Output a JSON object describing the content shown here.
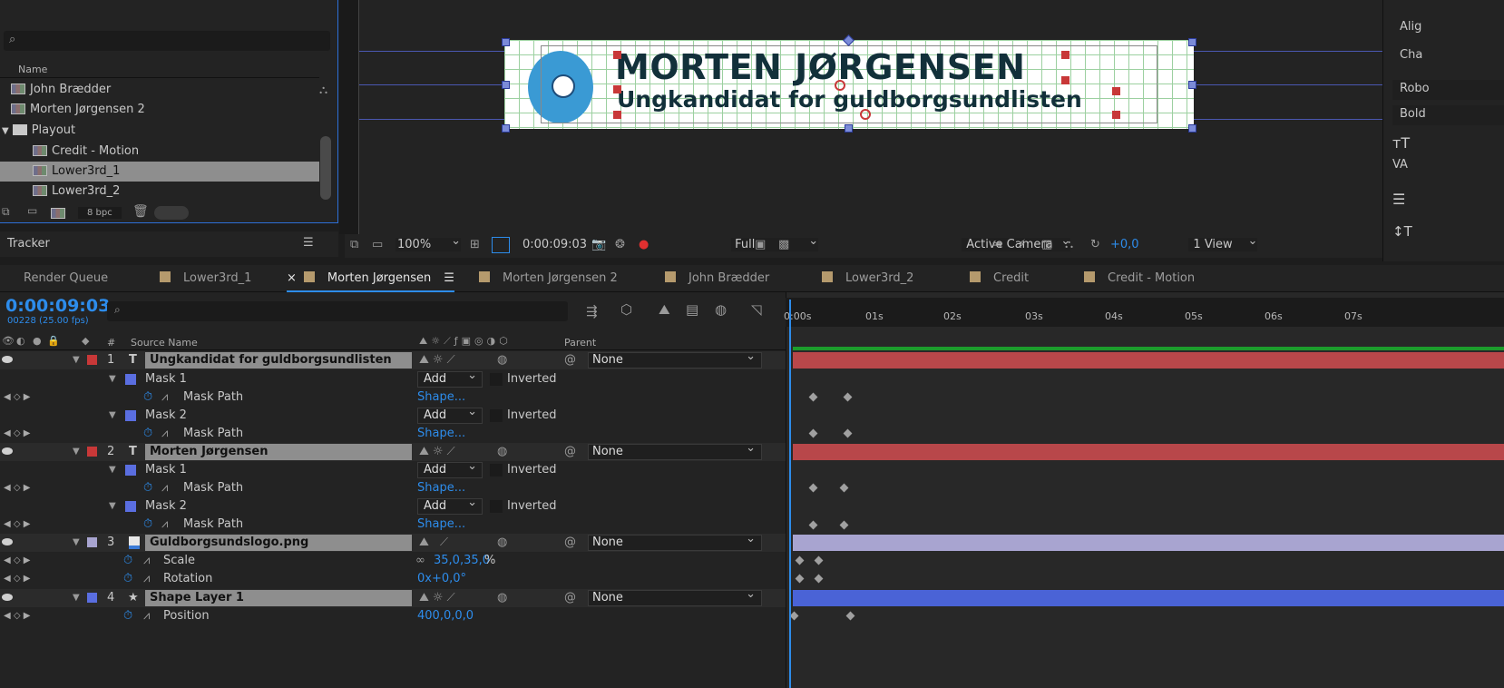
{
  "project": {
    "search_placeholder": "",
    "column_name": "Name",
    "items": [
      {
        "label": "John Brædder",
        "type": "comp",
        "indent": 0
      },
      {
        "label": "Morten Jørgensen 2",
        "type": "comp",
        "indent": 0
      },
      {
        "label": "Playout",
        "type": "folder",
        "indent": 0
      },
      {
        "label": "Credit - Motion",
        "type": "comp",
        "indent": 1
      },
      {
        "label": "Lower3rd_1",
        "type": "comp",
        "indent": 1,
        "selected": true
      },
      {
        "label": "Lower3rd_2",
        "type": "comp",
        "indent": 1
      }
    ],
    "bpc": "8 bpc"
  },
  "tracker": {
    "title": "Tracker"
  },
  "viewer": {
    "title_text": "MORTEN JØRGENSEN",
    "subtitle_text": "Ungkandidat for guldborgsundlisten",
    "zoom": "100%",
    "timecode": "0:00:09:03",
    "resolution": "Full",
    "camera": "Active Camera",
    "views": "1 View",
    "exposure": "+0,0"
  },
  "right_panel": {
    "items": [
      "Alig",
      "Cha",
      "Robo",
      "Bold"
    ]
  },
  "tabs": [
    {
      "label": "Render Queue",
      "swatch": false
    },
    {
      "label": "Lower3rd_1",
      "swatch": true
    },
    {
      "label": "Morten Jørgensen",
      "swatch": true,
      "active": true
    },
    {
      "label": "Morten Jørgensen 2",
      "swatch": true
    },
    {
      "label": "John Brædder",
      "swatch": true
    },
    {
      "label": "Lower3rd_2",
      "swatch": true
    },
    {
      "label": "Credit",
      "swatch": true
    },
    {
      "label": "Credit - Motion",
      "swatch": true
    }
  ],
  "timeline": {
    "timecode": "0:00:09:03",
    "frames": "00228 (25.00 fps)",
    "col_hash": "#",
    "col_source": "Source Name",
    "col_parent": "Parent",
    "ticks": [
      "0:00s",
      "01s",
      "02s",
      "03s",
      "04s",
      "05s",
      "06s",
      "07s"
    ],
    "layers": [
      {
        "num": "1",
        "name": "Ungkandidat for guldborgsundlisten",
        "label_color": "#c83838",
        "parent": "None",
        "type": "T"
      },
      {
        "num": "2",
        "name": "Morten Jørgensen",
        "label_color": "#c83838",
        "parent": "None",
        "type": "T"
      },
      {
        "num": "3",
        "name": "Guldborgsundslogo.png",
        "label_color": "#a8a4d0",
        "parent": "None",
        "type": "img"
      },
      {
        "num": "4",
        "name": "Shape Layer 1",
        "label_color": "#5a6ee0",
        "parent": "None",
        "type": "shape"
      }
    ],
    "mask1": "Mask 1",
    "mask2": "Mask 2",
    "mask_path": "Mask Path",
    "mode": "Add",
    "inverted": "Inverted",
    "shape_link": "Shape...",
    "scale_label": "Scale",
    "scale_value": "35,0,35,0",
    "scale_unit": "%",
    "rotation_label": "Rotation",
    "rotation_value": "0x+0,0°",
    "position_label": "Position",
    "position_value": "400,0,0,0"
  }
}
